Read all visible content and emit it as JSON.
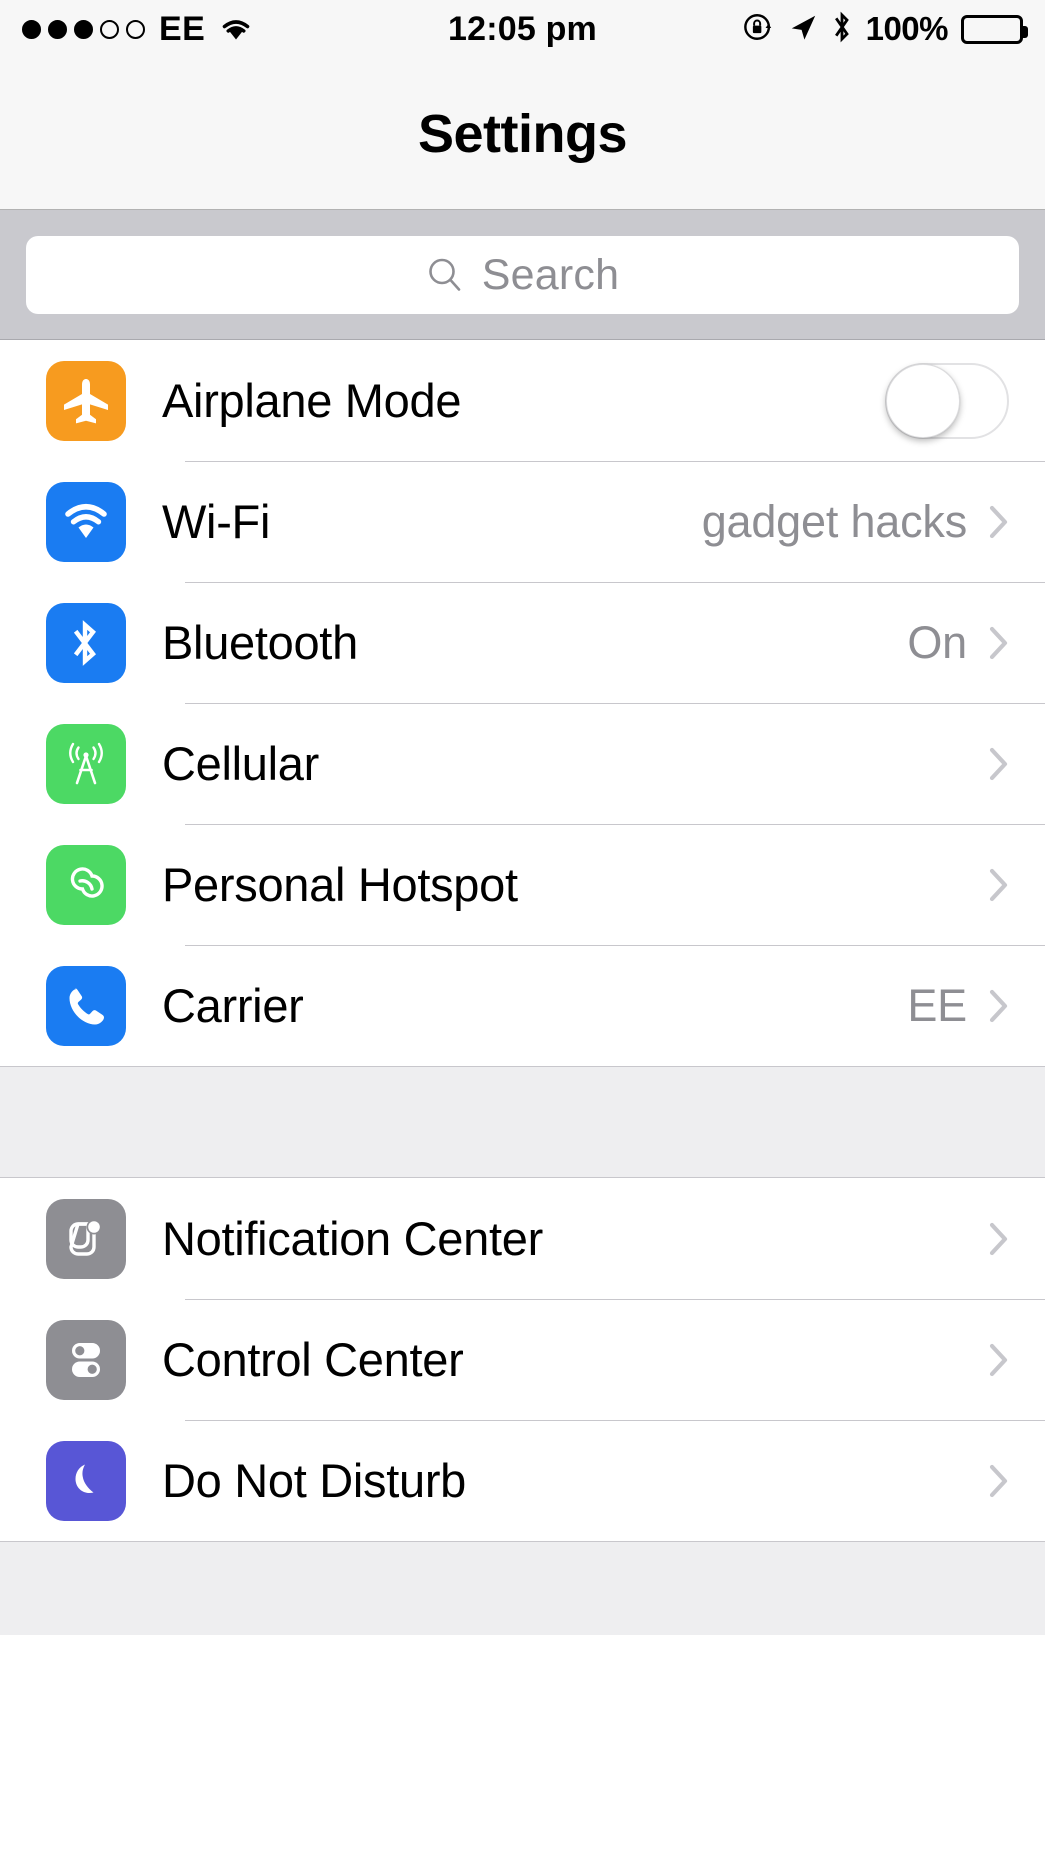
{
  "status_bar": {
    "signal_dots_filled": 3,
    "signal_dots_empty": 2,
    "carrier": "EE",
    "wifi_icon": "wifi-icon",
    "time": "12:05 pm",
    "rotation_lock_icon": "rotation-lock-icon",
    "location_icon": "location-arrow-icon",
    "bluetooth_icon": "bluetooth-icon",
    "battery_percent": "100%",
    "battery_icon": "battery-full-icon"
  },
  "nav": {
    "title": "Settings"
  },
  "search": {
    "placeholder": "Search",
    "value": "",
    "icon": "search-icon"
  },
  "sections": [
    {
      "rows": [
        {
          "label": "Airplane Mode",
          "icon": "airplane-icon",
          "icon_color": "#f79b1f",
          "control": "toggle",
          "toggle_on": false,
          "value": ""
        },
        {
          "label": "Wi-Fi",
          "icon": "wifi-icon",
          "icon_color": "#1a7cf2",
          "control": "chevron",
          "value": "gadget hacks"
        },
        {
          "label": "Bluetooth",
          "icon": "bluetooth-icon",
          "icon_color": "#1a7cf2",
          "control": "chevron",
          "value": "On"
        },
        {
          "label": "Cellular",
          "icon": "cellular-antenna-icon",
          "icon_color": "#4cd964",
          "control": "chevron",
          "value": ""
        },
        {
          "label": "Personal Hotspot",
          "icon": "hotspot-link-icon",
          "icon_color": "#4cd964",
          "control": "chevron",
          "value": ""
        },
        {
          "label": "Carrier",
          "icon": "phone-icon",
          "icon_color": "#1a7cf2",
          "control": "chevron",
          "value": "EE"
        }
      ]
    },
    {
      "rows": [
        {
          "label": "Notification Center",
          "icon": "notification-center-icon",
          "icon_color": "#8e8e93",
          "control": "chevron",
          "value": ""
        },
        {
          "label": "Control Center",
          "icon": "control-center-icon",
          "icon_color": "#8e8e93",
          "control": "chevron",
          "value": ""
        },
        {
          "label": "Do Not Disturb",
          "icon": "moon-icon",
          "icon_color": "#5856d6",
          "control": "chevron",
          "value": ""
        }
      ]
    }
  ],
  "colors": {
    "header_bg": "#f7f7f7",
    "search_bar_bg": "#c9c9ce",
    "separator": "#c8c7cc",
    "section_gap_bg": "#eeeef0",
    "value_text": "#8e8e93",
    "chevron": "#c7c7cc"
  }
}
